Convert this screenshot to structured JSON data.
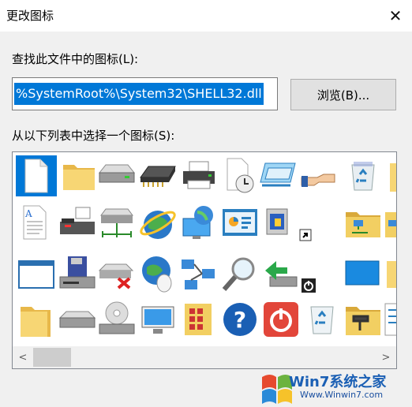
{
  "window": {
    "title": "更改图标",
    "close_glyph": "✕"
  },
  "file_label": "查找此文件中的图标(L):",
  "file_path": "%SystemRoot%\\System32\\SHELL32.dll",
  "browse_button": "浏览(B)...",
  "list_label": "从以下列表中选择一个图标(S):",
  "scrollbar": {
    "left_arrow": "<",
    "right_arrow": ">"
  },
  "icons_row1": [
    "blank-document-icon",
    "folder-icon",
    "drive-icon",
    "memory-chip-icon",
    "printer-icon",
    "clock-document-icon",
    "window-stack-icon",
    "hand-share-icon",
    "recycle-bin-full-icon",
    "folder-partial-icon"
  ],
  "icons_row2": [
    "text-document-icon",
    "fax-printer-icon",
    "network-drive-icon",
    "globe-ie-icon",
    "globe-monitor-icon",
    "control-panel-icon",
    "screensaver-icon",
    "shortcut-arrow-icon",
    "network-folder-icon",
    "folder-network-partial-icon"
  ],
  "icons_row3": [
    "window-icon",
    "floppy-drive-icon",
    "disconnected-drive-icon",
    "globe-mouse-icon",
    "network-computers-icon",
    "magnifier-icon",
    "usb-drive-icon",
    "power-small-icon",
    "blue-monitor-icon",
    "folder-partial-icon"
  ],
  "icons_row4": [
    "folder-icon",
    "removable-drive-icon",
    "cd-drive-icon",
    "monitor-icon",
    "folder-grid-icon",
    "help-icon",
    "power-icon",
    "recycle-bin-empty-icon",
    "tools-folder-icon",
    "checklist-icon"
  ],
  "watermark": {
    "brand": "Win7系统之家",
    "url": "Www.Winwin7.com"
  }
}
